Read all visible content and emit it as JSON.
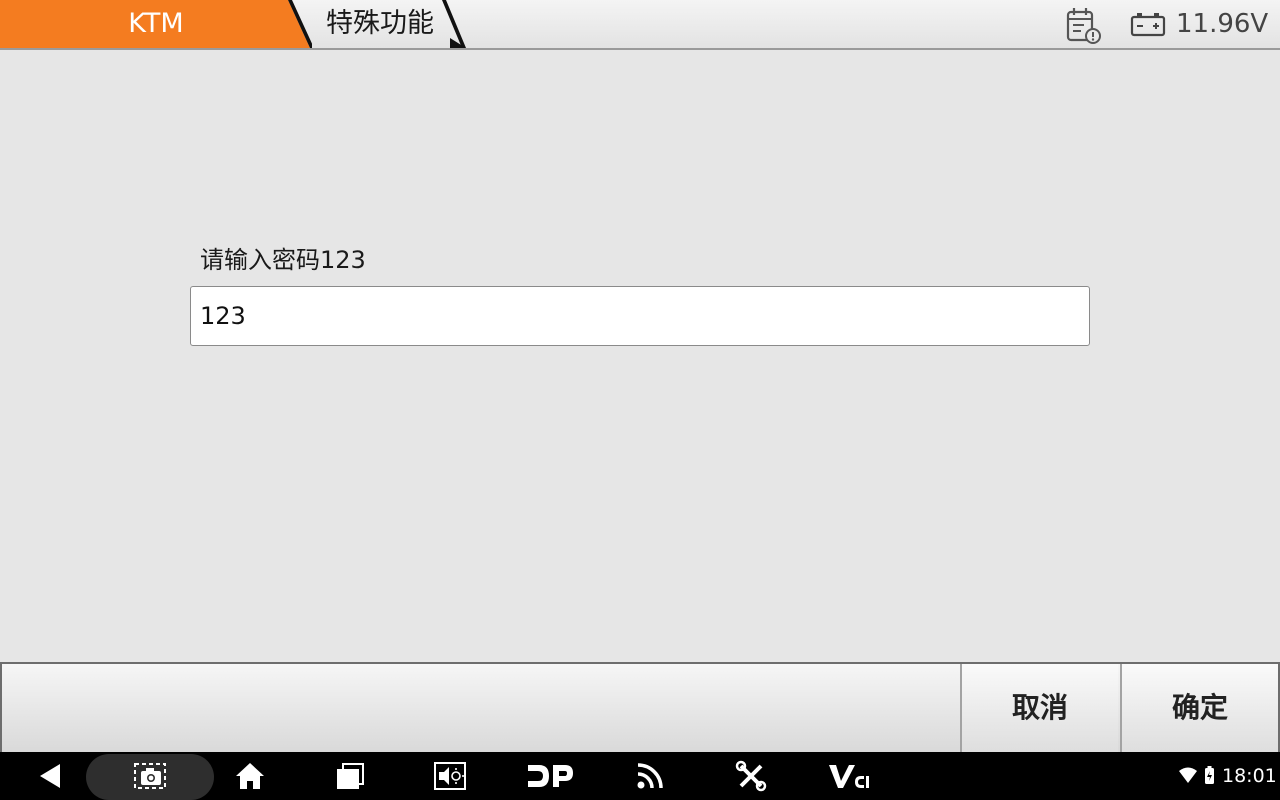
{
  "header": {
    "brand": "KTM",
    "function_title": "特殊功能",
    "voltage": "11.96V",
    "icons": {
      "report": "report-calendar-icon",
      "battery": "battery-icon"
    },
    "colors": {
      "brand_tab": "#f47c20"
    }
  },
  "main": {
    "prompt": "请输入密码123",
    "input_value": "123"
  },
  "actions": {
    "cancel_label": "取消",
    "ok_label": "确定"
  },
  "navbar": {
    "icons": [
      "back-icon",
      "screenshot-icon",
      "home-icon",
      "recent-apps-icon",
      "brightness-icon",
      "dp-icon",
      "remote-feed-icon",
      "toolbox-icon",
      "vci-icon"
    ],
    "time": "18:01"
  }
}
